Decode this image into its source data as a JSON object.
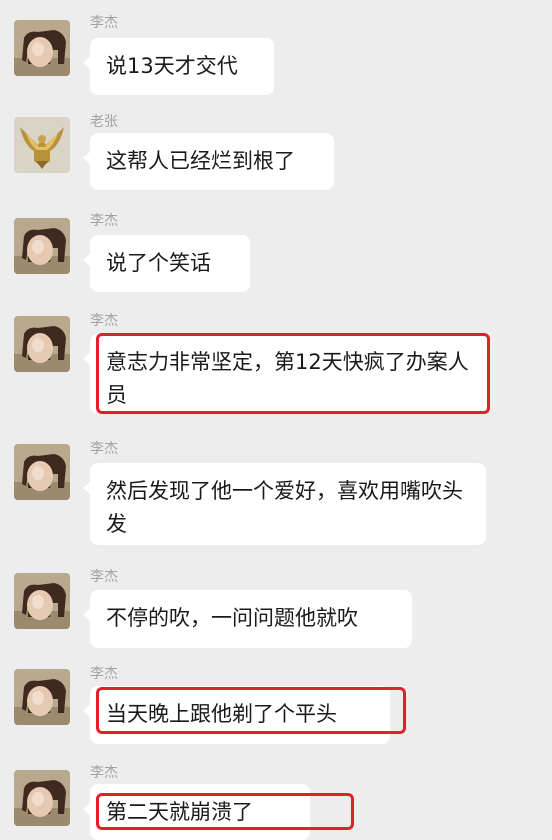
{
  "messages": [
    {
      "sender": "李杰",
      "avatar": "horse-avatar",
      "text": "说13天才交代",
      "highlighted": false
    },
    {
      "sender": "老张",
      "avatar": "eagle-avatar",
      "text": "这帮人已经烂到根了",
      "highlighted": false
    },
    {
      "sender": "李杰",
      "avatar": "horse-avatar",
      "text": "说了个笑话",
      "highlighted": false
    },
    {
      "sender": "李杰",
      "avatar": "horse-avatar",
      "text": "意志力非常坚定，第12天快疯了办案人员",
      "highlighted": true
    },
    {
      "sender": "李杰",
      "avatar": "horse-avatar",
      "text": "然后发现了他一个爱好，喜欢用嘴吹头发",
      "highlighted": false
    },
    {
      "sender": "李杰",
      "avatar": "horse-avatar",
      "text": "不停的吹，一问问题他就吹",
      "highlighted": false
    },
    {
      "sender": "李杰",
      "avatar": "horse-avatar",
      "text": "当天晚上跟他剃了个平头",
      "highlighted": true
    },
    {
      "sender": "李杰",
      "avatar": "horse-avatar",
      "text": "第二天就崩溃了",
      "highlighted": true
    }
  ],
  "colors": {
    "background": "#ededed",
    "bubble": "#ffffff",
    "highlight": "#e0202a",
    "sender": "#a3a3a3"
  }
}
